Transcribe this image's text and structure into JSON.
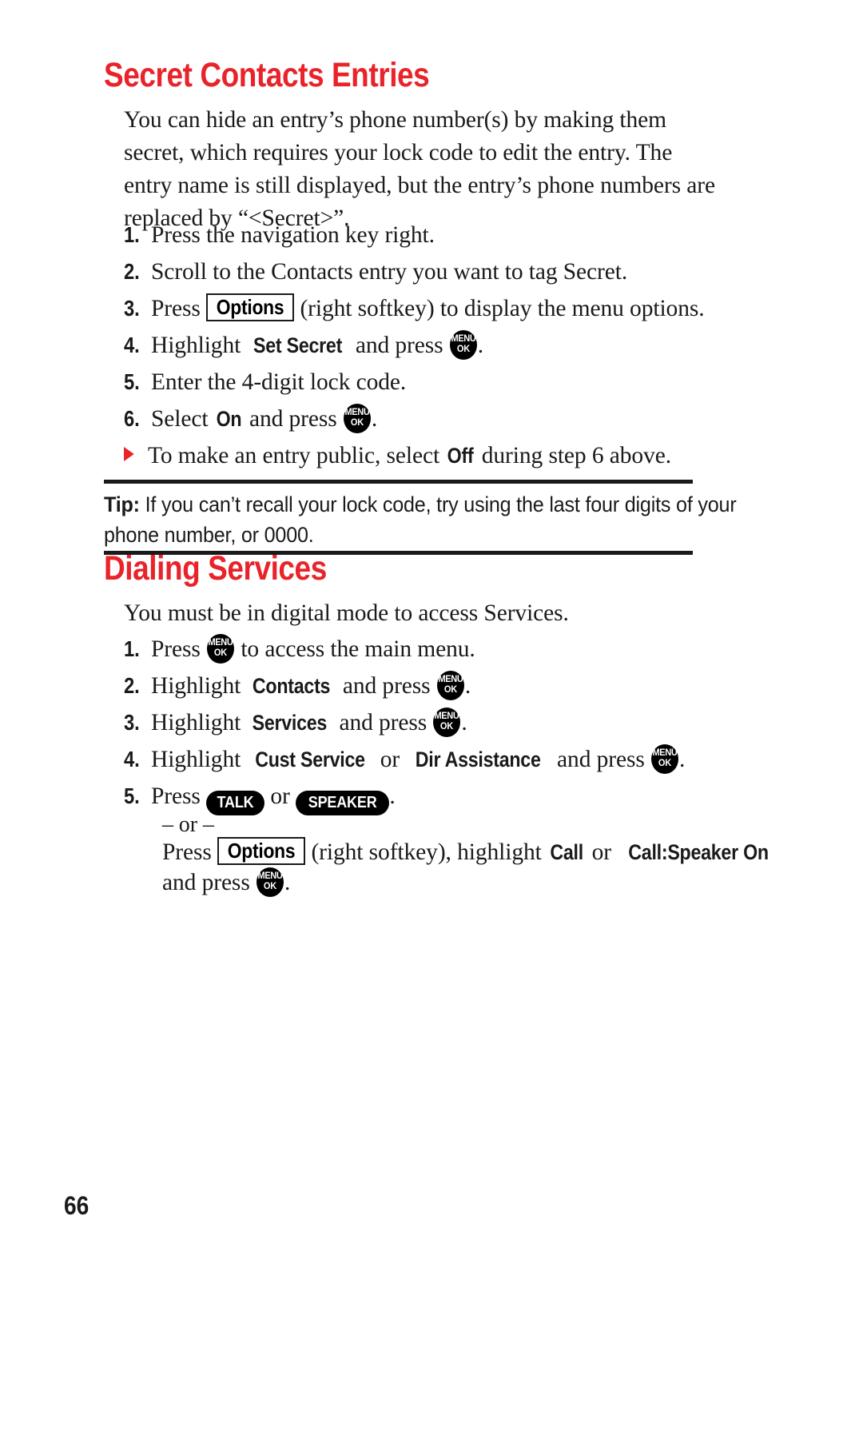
{
  "document": {
    "page_number": "66",
    "accent_color": "#e8232a",
    "text_color": "#1a1a1a",
    "background": "#ffffff"
  },
  "sections": [
    {
      "heading": "Secret Contacts Entries",
      "intro_lines": [
        "You can hide an entry’s phone number(s) by making them",
        "secret, which requires your lock code to edit the entry. The",
        "entry name is still displayed, but the entry’s phone numbers are",
        "replaced by “<Secret>”."
      ],
      "steps": [
        {
          "num": "1.",
          "text": "Press the navigation key right."
        },
        {
          "num": "2.",
          "text": "Scroll to the Contacts entry you want to tag Secret."
        },
        {
          "num": "3.",
          "pre": "Press ",
          "softkey": "Options",
          "post": " (right softkey) to display the menu options."
        },
        {
          "num": "4.",
          "pre": "Highlight ",
          "keyword": "Set Secret",
          "mid": " and press ",
          "menukey": true,
          "post": "."
        },
        {
          "num": "5.",
          "text": "Enter the 4-digit lock code."
        },
        {
          "num": "6.",
          "pre": "Select ",
          "keyword": "On",
          "mid": " and press ",
          "menukey": true,
          "post": "."
        }
      ],
      "bullet": {
        "pre": "To make an entry public, select ",
        "keyword": "Off",
        "post": " during step 6 above."
      }
    },
    {
      "heading": "Dialing Services",
      "intro_lines": [
        "You must be in digital mode to access Services."
      ],
      "steps": [
        {
          "num": "1.",
          "pre": "Press ",
          "menukey": true,
          "post": " to access the main menu."
        },
        {
          "num": "2.",
          "pre": "Highlight ",
          "keyword": "Contacts",
          "mid": " and press ",
          "menukey": true,
          "post": "."
        },
        {
          "num": "3.",
          "pre": "Highlight ",
          "keyword": "Services",
          "mid": " and press ",
          "menukey": true,
          "post": "."
        },
        {
          "num": "4.",
          "pre": "Highlight ",
          "keyword": "Cust Service",
          "mid": " or ",
          "keyword2": "Dir Assistance",
          "mid2": " and press ",
          "menukey": true,
          "post": "."
        },
        {
          "num": "5.",
          "pre": "Press ",
          "pill1": "TALK",
          "mid": " or ",
          "pill2": "SPEAKER",
          "post": "."
        }
      ],
      "or_separator": "– or –",
      "alt_step": {
        "pre": "Press ",
        "softkey": "Options",
        "mid": " (right softkey), highlight ",
        "keyword": "Call",
        "mid2": " or ",
        "keyword2": "Call:Speaker On",
        "tail_pre": "and press ",
        "tail_post": "."
      }
    }
  ],
  "tip": {
    "label": "Tip:",
    "line1_rest": " If you can’t recall your lock code, try using the last four digits of your",
    "line2": "phone number, or 0000."
  },
  "icons": {
    "menu_ok_top": "MENU",
    "menu_ok_bottom": "OK",
    "bullet": "triangle-bullet"
  }
}
